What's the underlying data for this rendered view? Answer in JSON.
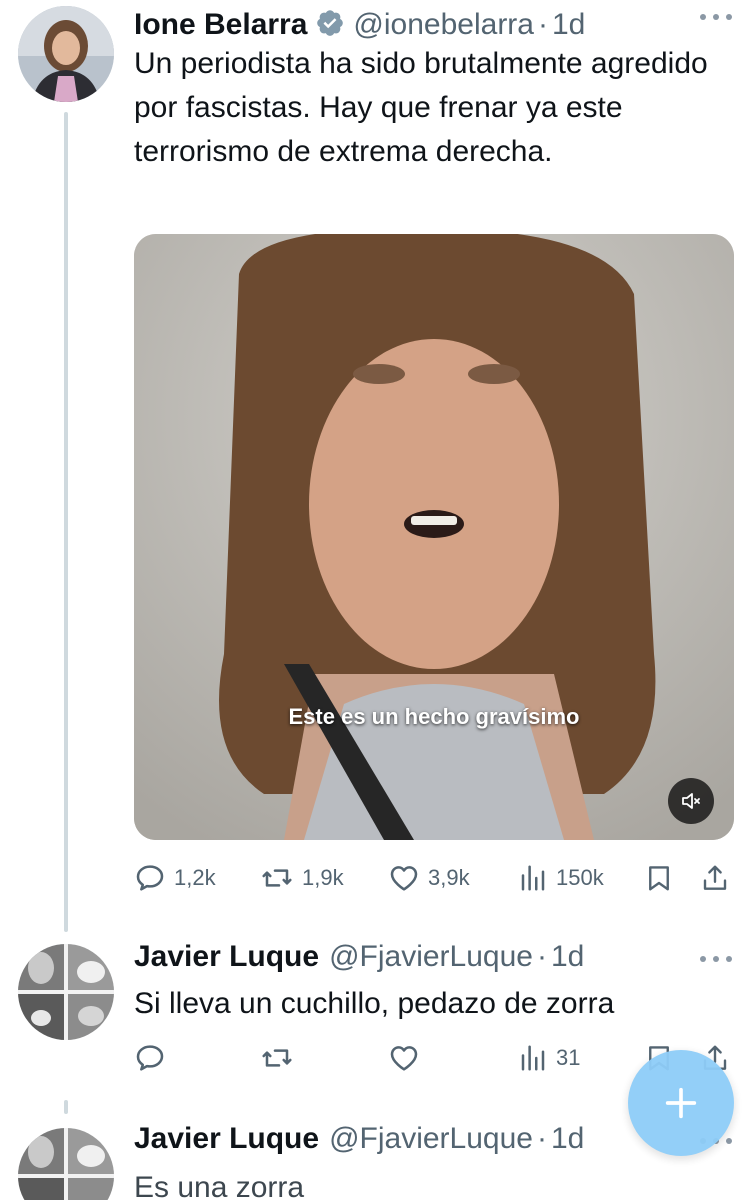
{
  "tweets": [
    {
      "name": "Ione Belarra",
      "handle": "@ionebelarra",
      "separator": "·",
      "time": "1d",
      "text": "Un periodista ha sido brutalmente agredido por fascistas. Hay que frenar ya este terrorismo de extrema derecha.",
      "media_caption": "Este es un hecho gravísimo",
      "stats": {
        "replies": "1,2k",
        "reposts": "1,9k",
        "likes": "3,9k",
        "views": "150k"
      }
    },
    {
      "name": "Javier Luque",
      "handle": "@FjavierLuque",
      "separator": "·",
      "time": "1d",
      "text": "Si lleva un cuchillo, pedazo de zorra",
      "stats": {
        "views": "31"
      }
    },
    {
      "name": "Javier Luque",
      "handle": "@FjavierLuque",
      "separator": "·",
      "time": "1d",
      "text": "Es una zorra"
    }
  ],
  "icons": {
    "verified": "verified-badge-icon",
    "reply": "reply-icon",
    "repost": "repost-icon",
    "like": "heart-icon",
    "views": "views-icon",
    "bookmark": "bookmark-icon",
    "share": "share-icon",
    "mute": "mute-icon",
    "compose": "plus-icon"
  },
  "colors": {
    "accent": "#1d9bf0",
    "fab": "#8ecdf8",
    "muted_text": "#536471"
  }
}
